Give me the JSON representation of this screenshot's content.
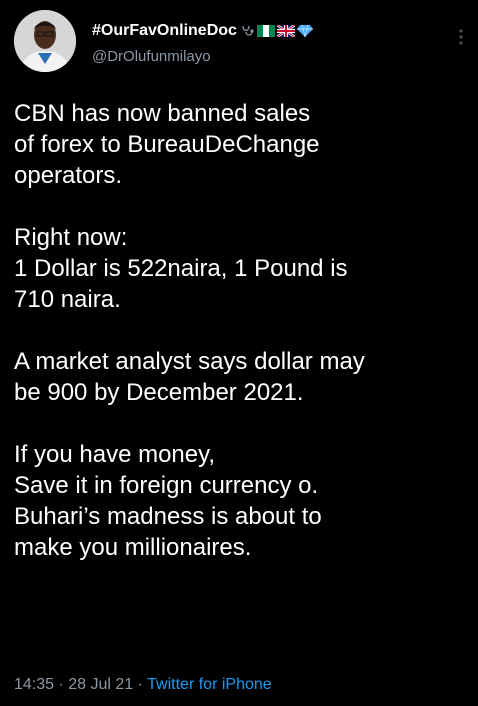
{
  "tweet": {
    "display_name": "#OurFavOnlineDoc",
    "handle": "@DrOlufunmilayo",
    "name_icons": [
      "stethoscope-icon",
      "nigeria-flag-icon",
      "uk-flag-icon",
      "blue-diamond-icon"
    ],
    "paragraphs": [
      [
        "CBN has now banned sales",
        "of forex to BureauDeChange",
        "operators."
      ],
      [
        "Right now:",
        "1 Dollar is 522naira, 1 Pound is",
        "710 naira."
      ],
      [
        "A market analyst says dollar may",
        "be 900 by December 2021."
      ],
      [
        "If you have money,",
        "Save it in foreign currency o.",
        "Buhari’s madness is about to",
        "make you millionaires."
      ]
    ],
    "time": "14:35",
    "separator": "·",
    "date": "28 Jul 21",
    "source": "Twitter for iPhone"
  },
  "colors": {
    "background": "#000000",
    "text": "#ffffff",
    "secondary_text": "#8b98a5",
    "link": "#1d9bf0"
  }
}
